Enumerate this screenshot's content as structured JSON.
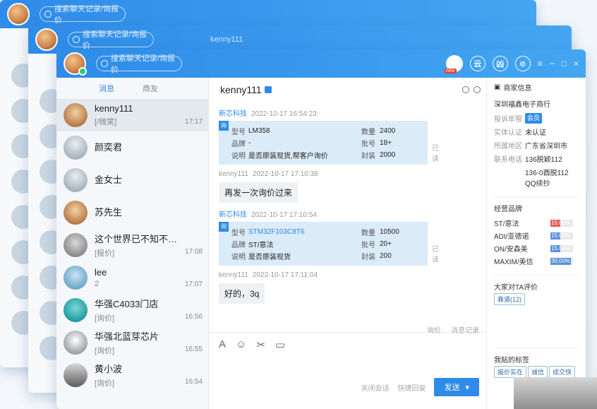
{
  "search_placeholder": "搜索聊天记录/询报价",
  "ghost_name": "kenny111",
  "toolbar": {
    "new_badge": "new",
    "icons": [
      "云",
      "凶",
      "⊙"
    ],
    "window_controls": [
      "≡",
      "−",
      "□",
      "×"
    ]
  },
  "tabs": [
    "消息",
    "商友"
  ],
  "contacts": [
    {
      "name": "kenny111",
      "sub": "[/微笑]",
      "time": "17:17",
      "avatar": "photo",
      "selected": true
    },
    {
      "name": "颜奕君",
      "sub": "",
      "time": "",
      "avatar": "silver"
    },
    {
      "name": "金女士",
      "sub": "",
      "time": "",
      "avatar": "silver"
    },
    {
      "name": "苏先生",
      "sub": "",
      "time": "",
      "avatar": "photo"
    },
    {
      "name": "这个世界已不知不觉的...",
      "sub": "[报价]",
      "time": "17:08",
      "avatar": "gray"
    },
    {
      "name": "lee",
      "sub": "2",
      "time": "17:07",
      "avatar": "blue"
    },
    {
      "name": "华强C4033门店",
      "sub": "[询价]",
      "time": "16:56",
      "avatar": "teal"
    },
    {
      "name": "华强北蓝芽芯片",
      "sub": "[询价]",
      "time": "16:55",
      "avatar": "dog"
    },
    {
      "name": "黄小波",
      "sub": "[询价]",
      "time": "16:54",
      "avatar": "bridge"
    }
  ],
  "chat": {
    "title": "kenny111",
    "messages": [
      {
        "sender": "新芯科技",
        "time": "2022-10-17 16:54:23",
        "type": "card",
        "corner": "询",
        "fields": [
          {
            "k": "型号",
            "v": "LM358",
            "k2": "数量",
            "v2": "2400"
          },
          {
            "k": "品牌",
            "v": "-",
            "k2": "批号",
            "v2": "18+"
          },
          {
            "k": "说明",
            "v": "是否原装现货,帮客户询价",
            "k2": "封装",
            "v2": "2000"
          }
        ],
        "status": "已读"
      },
      {
        "sender": "kenny111",
        "time": "2022-10-17 17:10:38",
        "type": "text",
        "text": "再发一次询价过来"
      },
      {
        "sender": "新芯科技",
        "time": "2022-10-17 17:10:54",
        "type": "card",
        "corner": "询",
        "fields": [
          {
            "k": "型号",
            "v": "STM32F103C8T6",
            "k2": "数量",
            "v2": "10500"
          },
          {
            "k": "品牌",
            "v": "ST/意法",
            "k2": "批号",
            "v2": "20+"
          },
          {
            "k": "说明",
            "v": "是否原装现货",
            "k2": "封装",
            "v2": "200"
          }
        ],
        "status": "已读"
      },
      {
        "sender": "kenny111",
        "time": "2022-10-17 17:11:04",
        "type": "text",
        "text": "好的，3q"
      }
    ],
    "compose_links": [
      "询价",
      "消息记录"
    ],
    "compose_tools": [
      "A",
      "☺",
      "✂",
      "▭"
    ],
    "footer": {
      "close": "关闭会话",
      "quick": "快捷回复",
      "send": "发送"
    }
  },
  "info": {
    "title": "商家信息",
    "company": "深圳福鑫电子商行",
    "rows": [
      {
        "label": "投诉年限",
        "value": "会员"
      },
      {
        "label": "实体认证",
        "value": "未认证"
      },
      {
        "label": "所属地区",
        "value": "广东省深圳市"
      },
      {
        "label": "联系电话",
        "value": "136脱颖112"
      },
      {
        "label": "",
        "value": "136-0酉脱112 QQ续抄"
      }
    ],
    "brands_title": "经营品牌",
    "brands": [
      {
        "name": "ST/意法",
        "pct": "15.00%",
        "ratio": 0.15,
        "color": "#e05a5a"
      },
      {
        "name": "ADI/亚德诺",
        "pct": "15.00%",
        "ratio": 0.15,
        "color": "#5b8fd9"
      },
      {
        "name": "ON/安森美",
        "pct": "15.00%",
        "ratio": 0.15,
        "color": "#5b8fd9"
      },
      {
        "name": "MAXIM/美信",
        "pct": "30.00%",
        "ratio": 0.3,
        "color": "#5b8fd9"
      }
    ],
    "rating_title": "大家对TA评价",
    "rating_btn": "靠谱(12)",
    "tags_title": "我贴的标签",
    "tags": [
      "报价实在",
      "诚信",
      "成交快"
    ]
  }
}
